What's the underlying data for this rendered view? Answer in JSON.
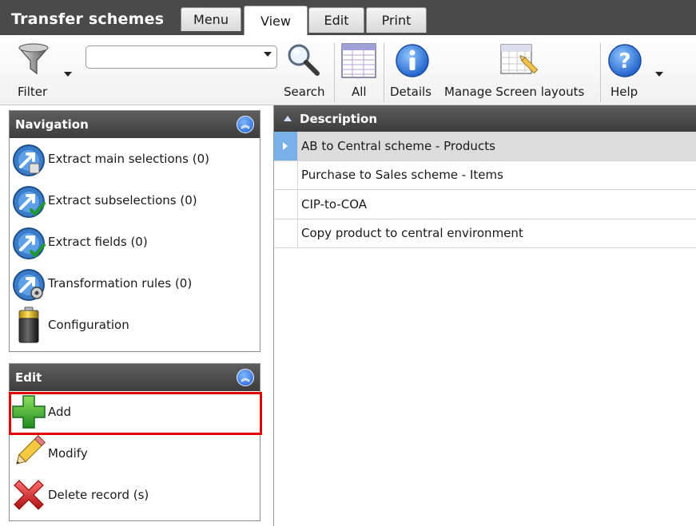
{
  "app": {
    "title": "Transfer schemes"
  },
  "tabs": [
    {
      "label": "Menu"
    },
    {
      "label": "View"
    },
    {
      "label": "Edit"
    },
    {
      "label": "Print"
    }
  ],
  "ribbon": {
    "filter_label": "Filter",
    "search_value": "",
    "search_label": "Search",
    "all_label": "All",
    "details_label": "Details",
    "layouts_label": "Manage Screen layouts",
    "help_label": "Help"
  },
  "navigation": {
    "title": "Navigation",
    "items": [
      {
        "label": "Extract main selections (0)",
        "icon": "extract-main-selections-icon"
      },
      {
        "label": "Extract subselections (0)",
        "icon": "extract-subselections-icon"
      },
      {
        "label": "Extract fields (0)",
        "icon": "extract-fields-icon"
      },
      {
        "label": "Transformation rules (0)",
        "icon": "transformation-rules-icon"
      },
      {
        "label": "Configuration",
        "icon": "battery-icon"
      }
    ]
  },
  "edit": {
    "title": "Edit",
    "items": [
      {
        "label": "Add",
        "icon": "plus-icon"
      },
      {
        "label": "Modify",
        "icon": "pencil-icon"
      },
      {
        "label": "Delete record (s)",
        "icon": "delete-x-icon"
      }
    ]
  },
  "grid": {
    "column": "Description",
    "rows": [
      "AB to Central scheme - Products",
      "Purchase to Sales scheme - Items",
      "CIP-to-COA",
      "Copy product to central environment"
    ],
    "selected_index": 0
  },
  "colors": {
    "header_dark": "#4a4a4a",
    "highlight_red": "#e00000",
    "selected_row": "#dcdcdc",
    "row_indicator": "#7ab0e8"
  }
}
